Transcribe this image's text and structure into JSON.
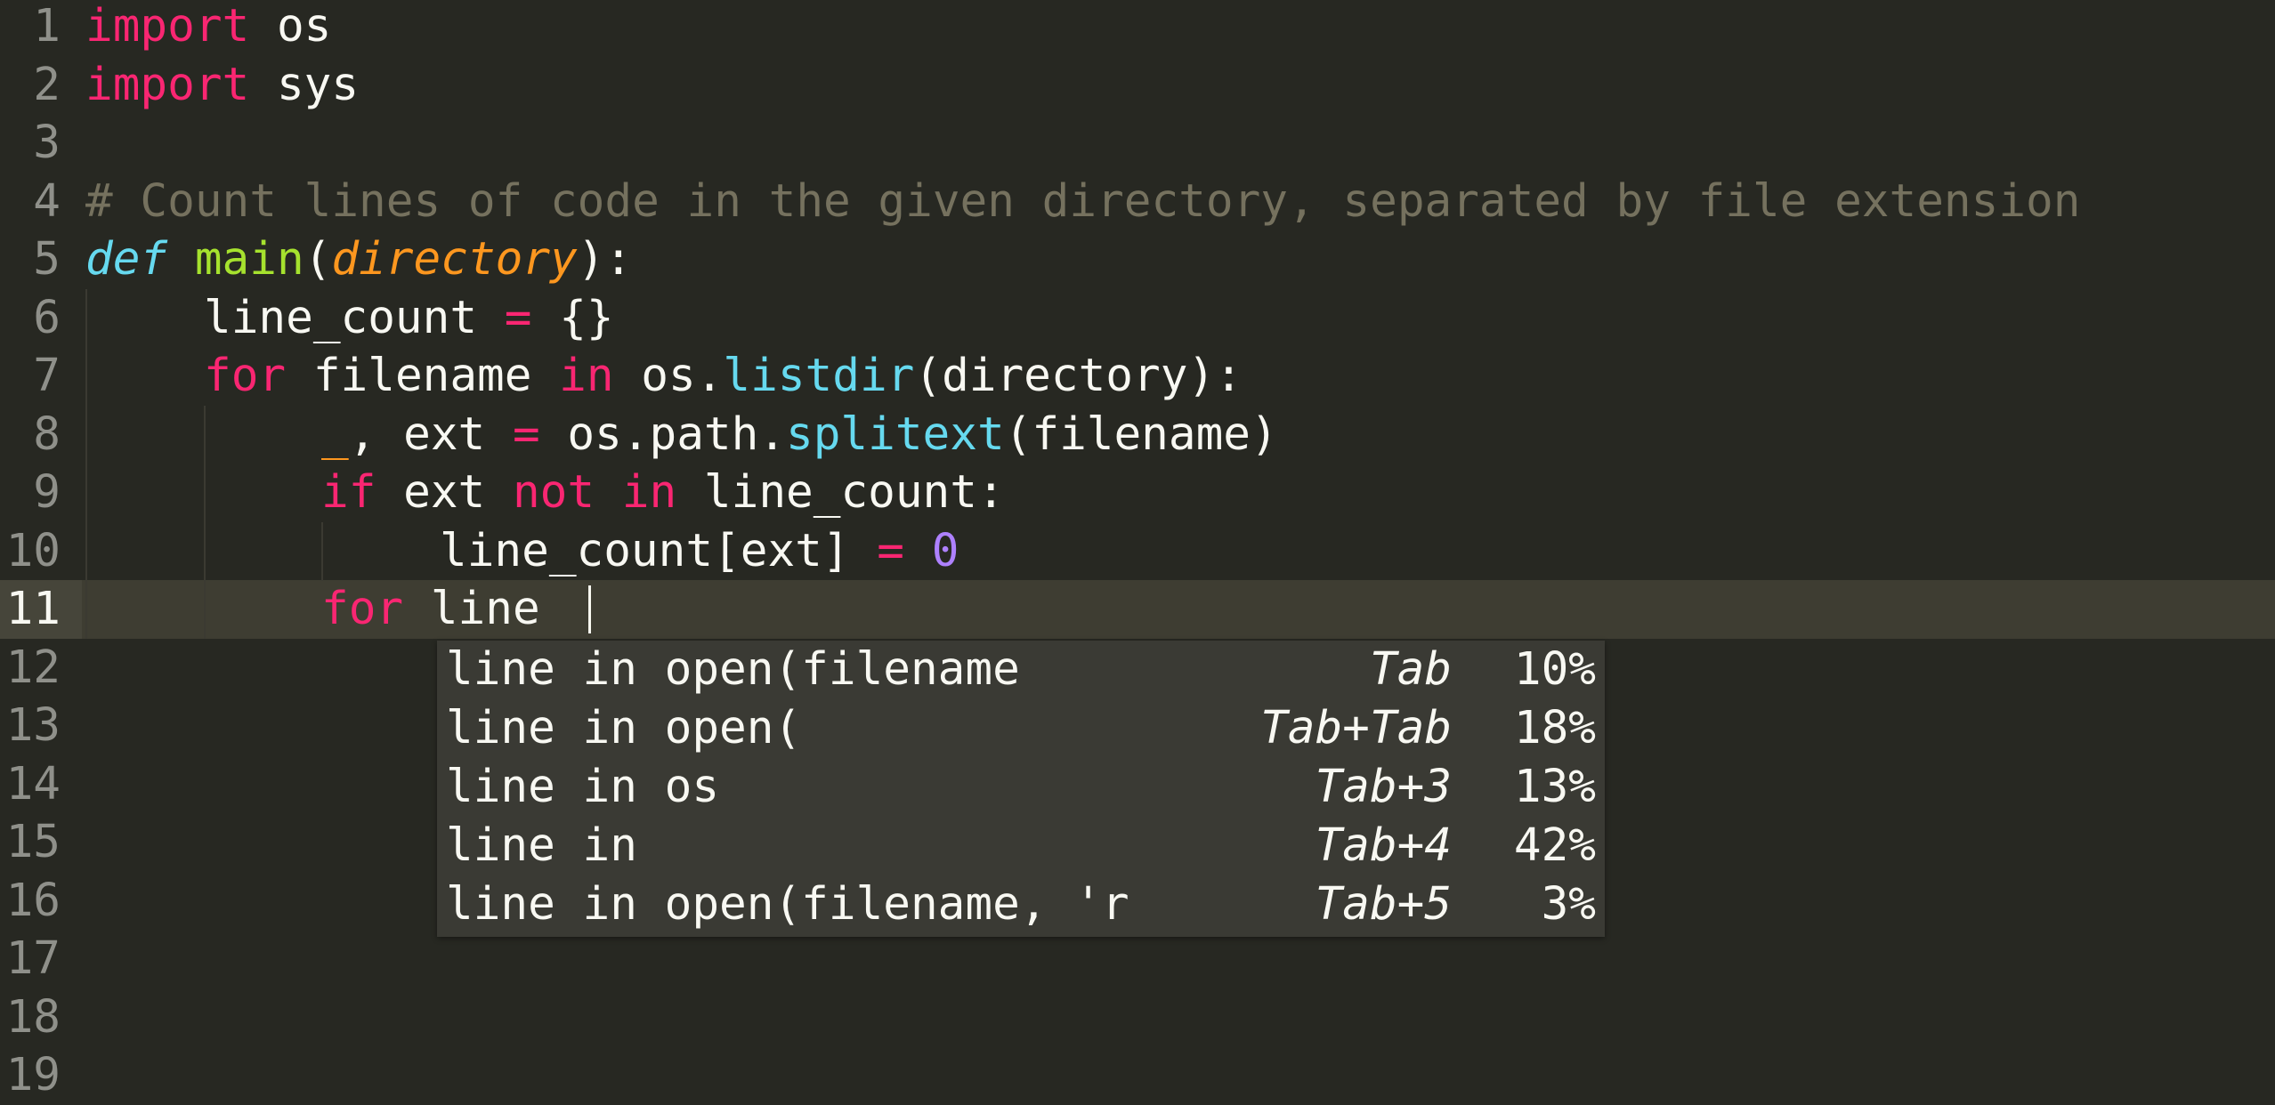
{
  "editor": {
    "line_numbers": [
      "1",
      "2",
      "3",
      "4",
      "5",
      "6",
      "7",
      "8",
      "9",
      "10",
      "11",
      "12",
      "13",
      "14",
      "15",
      "16",
      "17",
      "18",
      "19"
    ],
    "current_line": "11",
    "code": {
      "l1": {
        "import": "import",
        "mod": "os"
      },
      "l2": {
        "import": "import",
        "mod": "sys"
      },
      "l4": {
        "comment": "# Count lines of code in the given directory, separated by file extension"
      },
      "l5": {
        "def": "def",
        "name": "main",
        "open": "(",
        "param": "directory",
        "close": "):"
      },
      "l6": {
        "lhs": "line_count ",
        "eq": "=",
        "rhs": " {}"
      },
      "l7": {
        "for": "for",
        "var": " filename ",
        "in": "in",
        "obj": " os.",
        "call": "listdir",
        "args": "(directory):"
      },
      "l8": {
        "under": "_",
        "lhs": ", ext ",
        "eq": "=",
        "obj": " os.path.",
        "call": "splitext",
        "args": "(filename)"
      },
      "l9": {
        "if": "if",
        "var": " ext ",
        "not": "not",
        "sp": " ",
        "in": "in",
        "rest": " line_count:"
      },
      "l10": {
        "lhs": "line_count[ext] ",
        "eq": "=",
        "sp": " ",
        "num": "0"
      },
      "l11": {
        "for": "for",
        "rest": " line "
      }
    }
  },
  "autocomplete": {
    "items": [
      {
        "text": "line in open(filename",
        "key": "Tab",
        "pct": "10%"
      },
      {
        "text": "line in open(",
        "key": "Tab+Tab",
        "pct": "18%"
      },
      {
        "text": "line in os",
        "key": "Tab+3",
        "pct": "13%"
      },
      {
        "text": "line in",
        "key": "Tab+4",
        "pct": "42%"
      },
      {
        "text": "line in open(filename, 'r",
        "key": "Tab+5",
        "pct": "3%"
      }
    ]
  },
  "theme": {
    "background": "#272822",
    "keyword": "#f92672",
    "storage": "#66d9ef",
    "function": "#a6e22e",
    "parameter": "#fd971f",
    "comment": "#75715e",
    "number": "#ae81ff",
    "foreground": "#f8f8f2",
    "popup_background": "#3a3a34"
  }
}
